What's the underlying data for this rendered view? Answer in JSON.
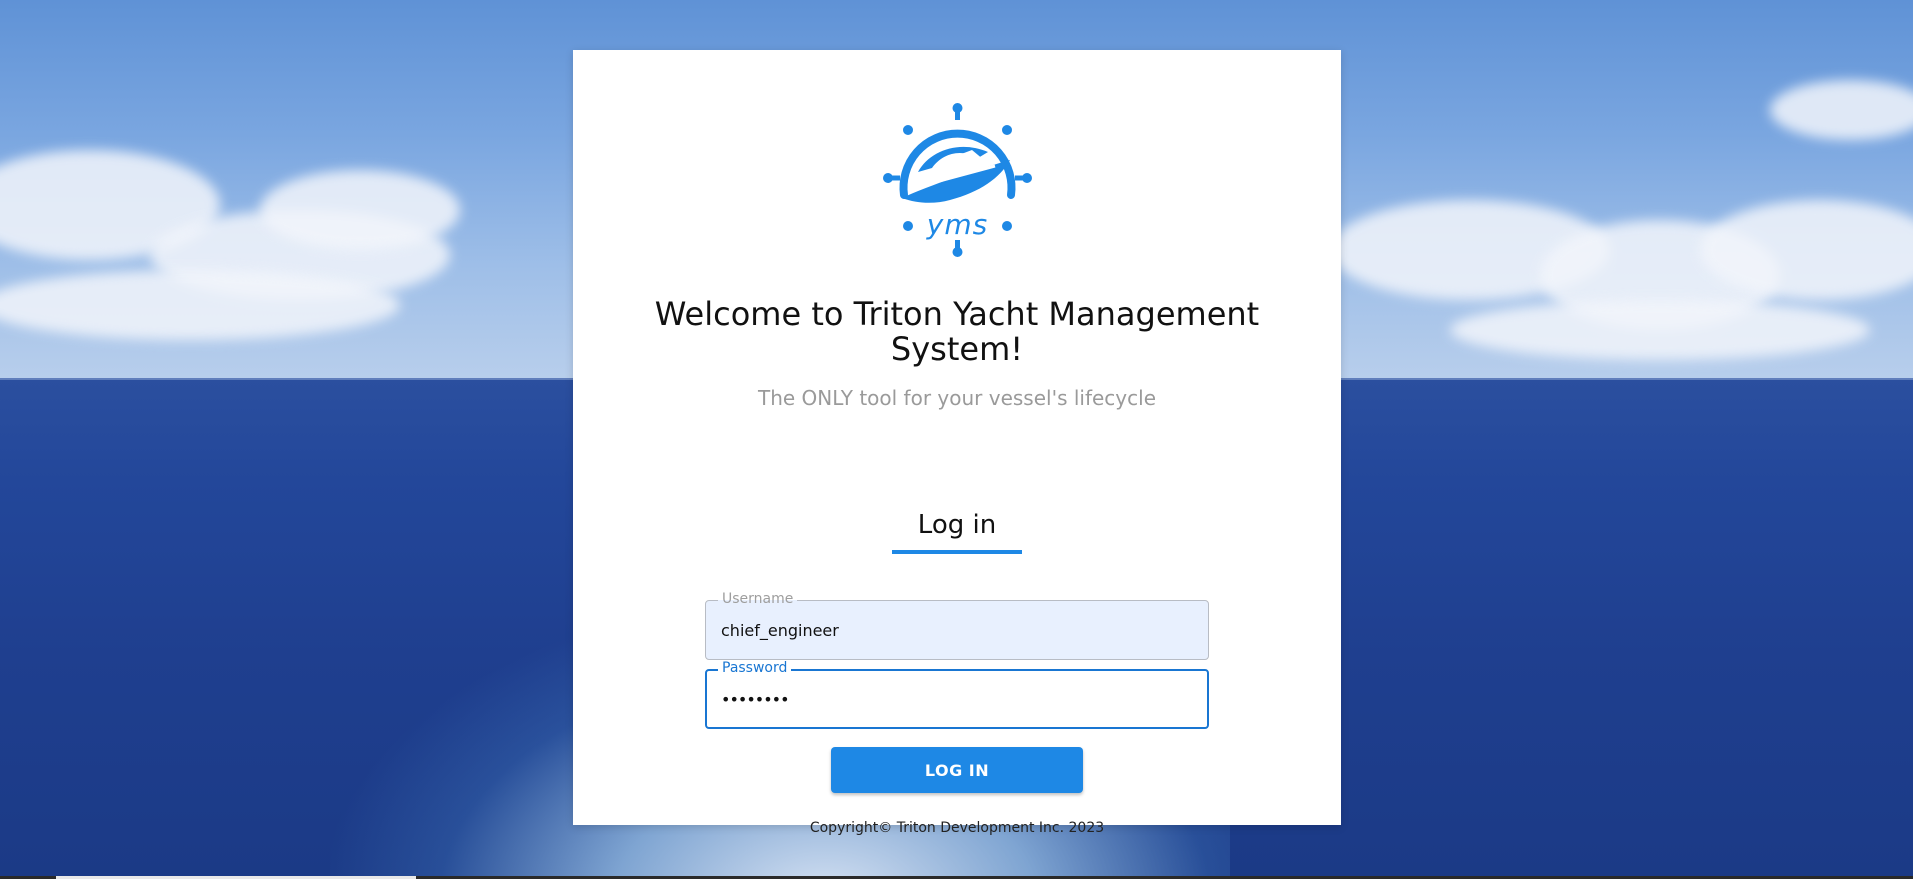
{
  "brand": {
    "logo_text": "yms",
    "accent_color": "#1e88e5"
  },
  "header": {
    "title": "Welcome to Triton Yacht Management System!",
    "subtitle": "The ONLY tool for your vessel's lifecycle"
  },
  "tabs": [
    {
      "label": "Log in",
      "active": true
    }
  ],
  "form": {
    "username": {
      "label": "Username",
      "value": "chief_engineer"
    },
    "password": {
      "label": "Password",
      "value": "••••••••"
    },
    "submit_label": "LOG IN"
  },
  "footer": {
    "copyright": "Copyright© Triton Development Inc. 2023"
  }
}
